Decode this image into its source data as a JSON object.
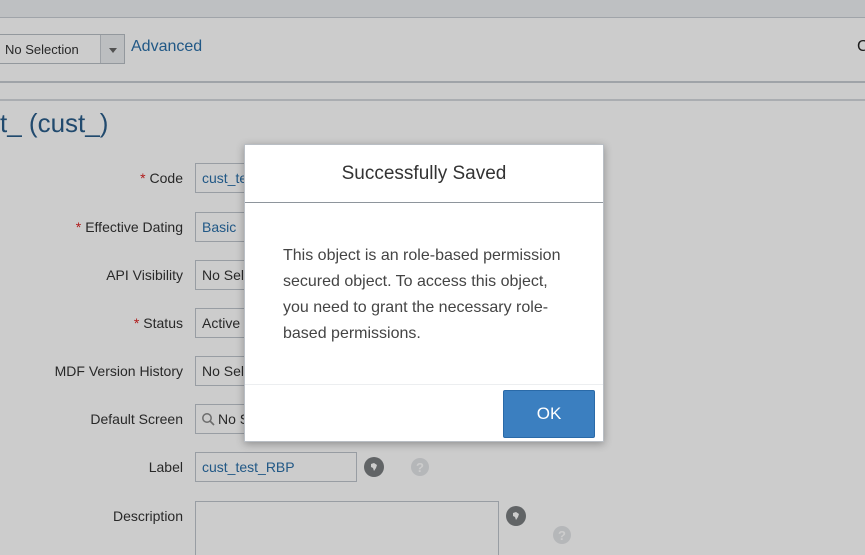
{
  "toolbar": {
    "select_value": "No Selection",
    "advanced_label": "Advanced",
    "right_edge_text": "C"
  },
  "page_title": "t_ (cust_)",
  "form": {
    "code": {
      "label": "Code",
      "value": "cust_te"
    },
    "effective_dating": {
      "label": "Effective Dating",
      "value": "Basic"
    },
    "api_visibility": {
      "label": "API Visibility",
      "value": "No Sel"
    },
    "status": {
      "label": "Status",
      "value": "Active"
    },
    "mdf_version_history": {
      "label": "MDF Version History",
      "value": "No Sel"
    },
    "default_screen": {
      "label": "Default Screen",
      "value": "No S"
    },
    "label_field": {
      "label": "Label",
      "value": "cust_test_RBP"
    },
    "description": {
      "label": "Description",
      "value": ""
    },
    "required_marker": "*",
    "help_glyph": "?"
  },
  "dialog": {
    "title": "Successfully Saved",
    "message": "This object is an role-based permission secured object. To access this object, you need to grant the necessary role-based permissions.",
    "ok_label": "OK"
  },
  "colors": {
    "accent": "#3b7fc0",
    "link": "#2a6fa8",
    "required": "#dd2222"
  }
}
